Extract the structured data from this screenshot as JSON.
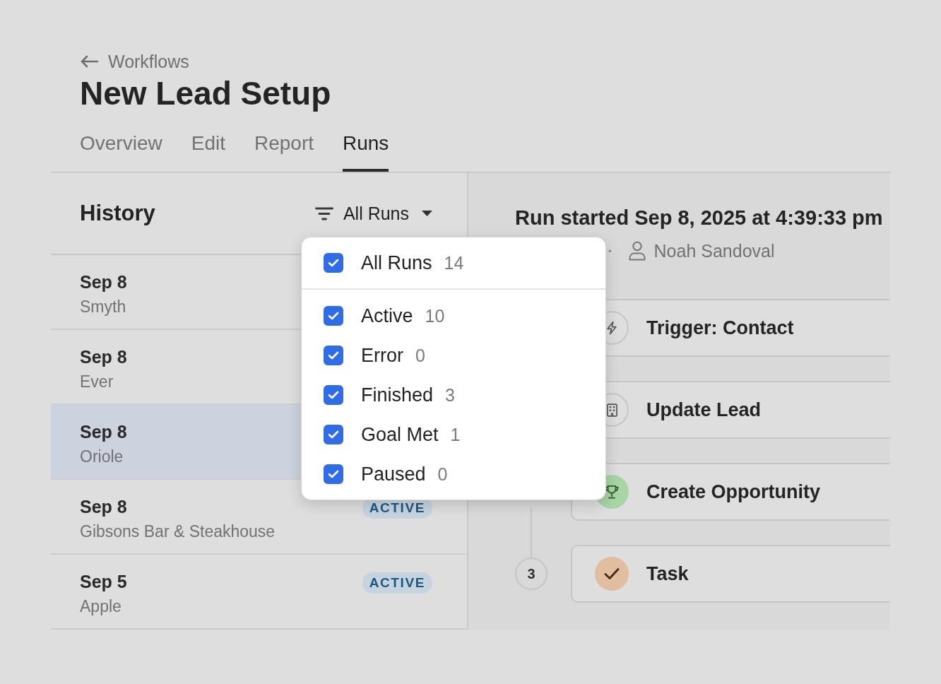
{
  "breadcrumb": {
    "label": "Workflows"
  },
  "title": "New Lead Setup",
  "tabs": [
    {
      "label": "Overview",
      "selected": false
    },
    {
      "label": "Edit",
      "selected": false
    },
    {
      "label": "Report",
      "selected": false
    },
    {
      "label": "Runs",
      "selected": true
    }
  ],
  "history": {
    "title": "History",
    "filter": {
      "label": "All Runs",
      "expanded": true,
      "options": [
        {
          "kind": "all",
          "label": "All Runs",
          "count": "14",
          "checked": true
        },
        {
          "kind": "status",
          "label": "Active",
          "count": "10",
          "checked": true
        },
        {
          "kind": "status",
          "label": "Error",
          "count": "0",
          "checked": true
        },
        {
          "kind": "status",
          "label": "Finished",
          "count": "3",
          "checked": true
        },
        {
          "kind": "status",
          "label": "Goal Met",
          "count": "1",
          "checked": true
        },
        {
          "kind": "status",
          "label": "Paused",
          "count": "0",
          "checked": true
        }
      ]
    },
    "runs": [
      {
        "date": "Sep 8",
        "name": "Smyth",
        "selected": false
      },
      {
        "date": "Sep 8",
        "name": "Ever",
        "selected": false
      },
      {
        "date": "Sep 8",
        "name": "Oriole",
        "selected": true
      },
      {
        "date": "Sep 8",
        "name": "Gibsons Bar & Steakhouse",
        "selected": false,
        "status": "ACTIVE"
      },
      {
        "date": "Sep 5",
        "name": "Apple",
        "selected": false,
        "status": "ACTIVE"
      }
    ]
  },
  "run": {
    "title": "Run started Sep 8, 2025 at 4:39:33 pm",
    "separator": "•",
    "user": "Noah Sandoval",
    "steps": [
      {
        "kind": "trigger",
        "title": "Trigger: Contact"
      },
      {
        "kind": "record",
        "title": "Update Lead"
      },
      {
        "kind": "goal",
        "title": "Create Opportunity"
      },
      {
        "kind": "task",
        "title": "Task",
        "number": "3"
      }
    ]
  }
}
